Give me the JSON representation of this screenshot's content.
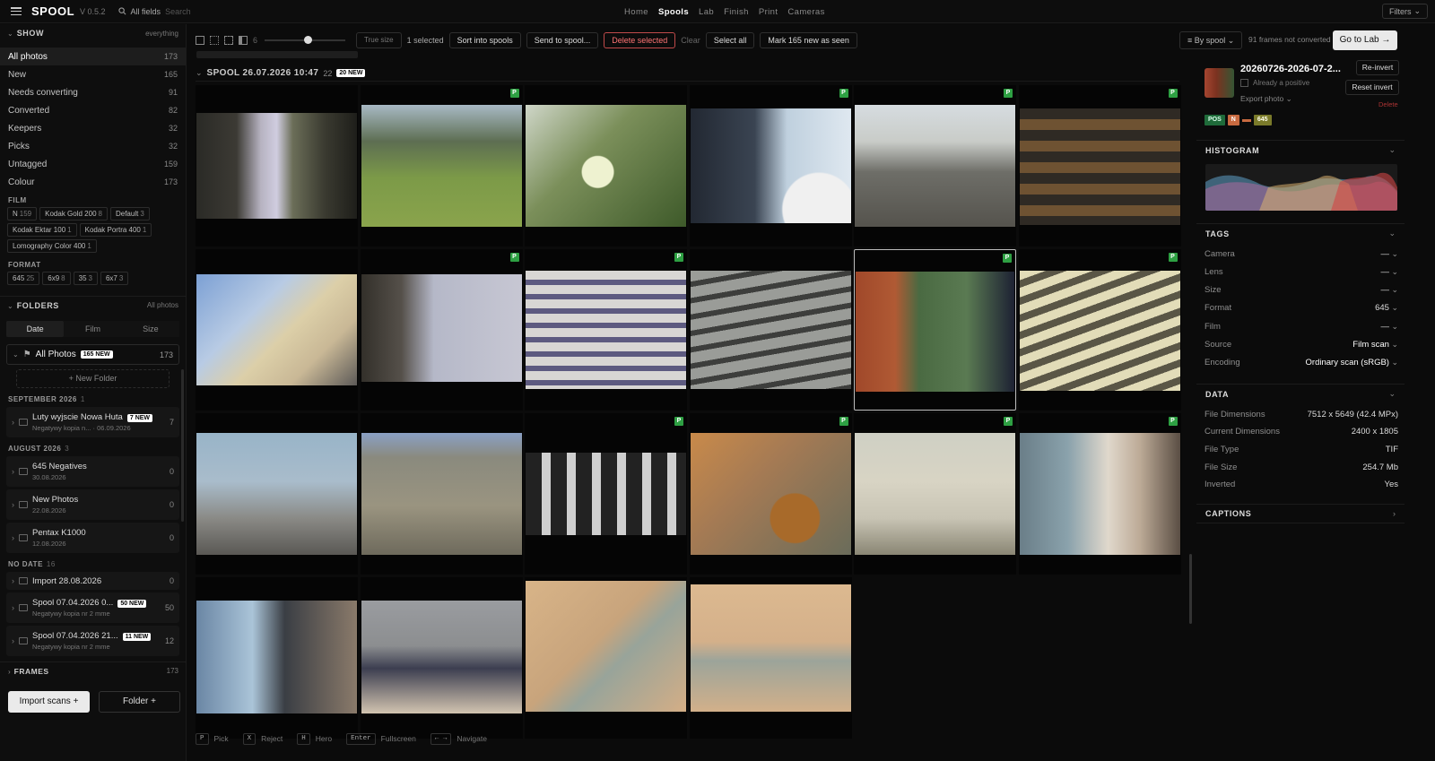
{
  "app": {
    "name": "SPOOL",
    "version": "V 0.5.2"
  },
  "search": {
    "scope": "All fields",
    "placeholder": "Search"
  },
  "nav": [
    "Home",
    "Spools",
    "Lab",
    "Finish",
    "Print",
    "Cameras"
  ],
  "nav_active": "Spools",
  "filters_label": "Filters",
  "show": {
    "title": "SHOW",
    "scope": "everything",
    "items": [
      {
        "label": "All photos",
        "count": "173"
      },
      {
        "label": "New",
        "count": "165"
      },
      {
        "label": "Needs converting",
        "count": "91"
      },
      {
        "label": "Converted",
        "count": "82"
      },
      {
        "label": "Keepers",
        "count": "32"
      },
      {
        "label": "Picks",
        "count": "32"
      },
      {
        "label": "Untagged",
        "count": "159"
      },
      {
        "label": "Colour",
        "count": "173"
      }
    ]
  },
  "film": {
    "title": "FILM",
    "tags": [
      {
        "label": "N",
        "count": "159"
      },
      {
        "label": "Kodak Gold 200",
        "count": "8"
      },
      {
        "label": "Default",
        "count": "3"
      },
      {
        "label": "Kodak Ektar 100",
        "count": "1"
      },
      {
        "label": "Kodak Portra 400",
        "count": "1"
      },
      {
        "label": "Lomography Color 400",
        "count": "1"
      }
    ]
  },
  "format": {
    "title": "FORMAT",
    "tags": [
      {
        "label": "645",
        "count": "25"
      },
      {
        "label": "6x9",
        "count": "8"
      },
      {
        "label": "35",
        "count": "3"
      },
      {
        "label": "6x7",
        "count": "3"
      }
    ]
  },
  "folders": {
    "title": "FOLDERS",
    "scope": "All photos",
    "tabs": [
      "Date",
      "Film",
      "Size"
    ],
    "all_photos": {
      "label": "All Photos",
      "badge": "165 NEW",
      "count": "173"
    },
    "new_folder": "New Folder",
    "groups": [
      {
        "title": "SEPTEMBER 2026",
        "count": "1",
        "items": [
          {
            "name": "Luty wyjscie Nowa Huta",
            "badge": "7 NEW",
            "sub": "Negatywy kopia n... · 06.09.2026",
            "count": "7"
          }
        ]
      },
      {
        "title": "AUGUST 2026",
        "count": "3",
        "items": [
          {
            "name": "645 Negatives",
            "sub": "30.08.2026",
            "count": "0"
          },
          {
            "name": "New Photos",
            "sub": "22.08.2026",
            "count": "0"
          },
          {
            "name": "Pentax K1000",
            "sub": "12.08.2026",
            "count": "0"
          }
        ]
      },
      {
        "title": "NO DATE",
        "count": "16",
        "items": [
          {
            "name": "Import 28.08.2026",
            "sub": "",
            "count": "0"
          },
          {
            "name": "Spool 07.04.2026 0...",
            "badge": "50 NEW",
            "sub": "Negatywy kopia nr 2 mme",
            "count": "50"
          },
          {
            "name": "Spool 07.04.2026 21...",
            "badge": "11 NEW",
            "sub": "Negatywy kopia nr 2 mme",
            "count": "12"
          }
        ]
      }
    ]
  },
  "frames": {
    "title": "FRAMES",
    "count": "173"
  },
  "import_label": "Import scans +",
  "folder_btn_label": "Folder +",
  "toolbar": {
    "zoom_level": "6",
    "true_size": "True size",
    "selected": "1 selected",
    "sort": "Sort into spools",
    "send": "Send to spool...",
    "delete": "Delete selected",
    "clear": "Clear",
    "select_all": "Select all",
    "mark_seen": "Mark 165 new as seen",
    "by_spool": "By spool",
    "not_converted": "91 frames not converted",
    "go_lab": "Go to Lab →"
  },
  "spool": {
    "title": "SPOOL 26.07.2026 10:47",
    "count": "22",
    "badge": "20 NEW"
  },
  "photos": [
    {
      "picked": false,
      "sel": false,
      "style": "window"
    },
    {
      "picked": true,
      "sel": false,
      "style": "dog"
    },
    {
      "picked": false,
      "sel": false,
      "style": "flower"
    },
    {
      "picked": true,
      "sel": false,
      "style": "wheel"
    },
    {
      "picked": true,
      "sel": false,
      "style": "block"
    },
    {
      "picked": true,
      "sel": false,
      "style": "greenbal"
    },
    {
      "picked": false,
      "sel": false,
      "style": "bluetower"
    },
    {
      "picked": true,
      "sel": false,
      "style": "lamp"
    },
    {
      "picked": true,
      "sel": false,
      "style": "balc1"
    },
    {
      "picked": false,
      "sel": false,
      "style": "balc2"
    },
    {
      "picked": true,
      "sel": true,
      "style": "redwall"
    },
    {
      "picked": true,
      "sel": false,
      "style": "curve"
    },
    {
      "picked": false,
      "sel": false,
      "style": "stepped"
    },
    {
      "picked": false,
      "sel": false,
      "style": "brick"
    },
    {
      "picked": true,
      "sel": false,
      "style": "bw"
    },
    {
      "picked": true,
      "sel": false,
      "style": "orange"
    },
    {
      "picked": true,
      "sel": false,
      "style": "facade"
    },
    {
      "picked": true,
      "sel": false,
      "style": "man"
    },
    {
      "picked": false,
      "sel": false,
      "style": "shop"
    },
    {
      "picked": false,
      "sel": false,
      "style": "garage"
    },
    {
      "picked": false,
      "sel": false,
      "style": "neg1"
    },
    {
      "picked": false,
      "sel": false,
      "style": "neg2"
    }
  ],
  "pick_badge": "P",
  "detail": {
    "filename": "20260726-2026-07-2...",
    "already_positive": "Already a positive",
    "export": "Export photo",
    "reinvert": "Re-invert",
    "reset_invert": "Reset invert",
    "delete": "Delete",
    "chips": [
      "POS",
      "N",
      "645"
    ]
  },
  "histogram_title": "HISTOGRAM",
  "tags_section": {
    "title": "TAGS",
    "rows": [
      {
        "k": "Camera",
        "v": "—"
      },
      {
        "k": "Lens",
        "v": "—"
      },
      {
        "k": "Size",
        "v": "—"
      },
      {
        "k": "Format",
        "v": "645"
      },
      {
        "k": "Film",
        "v": "—"
      },
      {
        "k": "Source",
        "v": "Film scan"
      },
      {
        "k": "Encoding",
        "v": "Ordinary scan (sRGB)"
      }
    ]
  },
  "data_section": {
    "title": "DATA",
    "rows": [
      {
        "k": "File Dimensions",
        "v": "7512 x 5649 (42.4 MPx)"
      },
      {
        "k": "Current Dimensions",
        "v": "2400 x 1805"
      },
      {
        "k": "File Type",
        "v": "TIF"
      },
      {
        "k": "File Size",
        "v": "254.7 Mb"
      },
      {
        "k": "Inverted",
        "v": "Yes"
      }
    ]
  },
  "captions_title": "CAPTIONS",
  "hints": [
    {
      "key": "P",
      "label": "Pick"
    },
    {
      "key": "X",
      "label": "Reject"
    },
    {
      "key": "H",
      "label": "Hero"
    },
    {
      "key": "Enter",
      "label": "Fullscreen"
    },
    {
      "key": "← →",
      "label": "Navigate"
    }
  ]
}
